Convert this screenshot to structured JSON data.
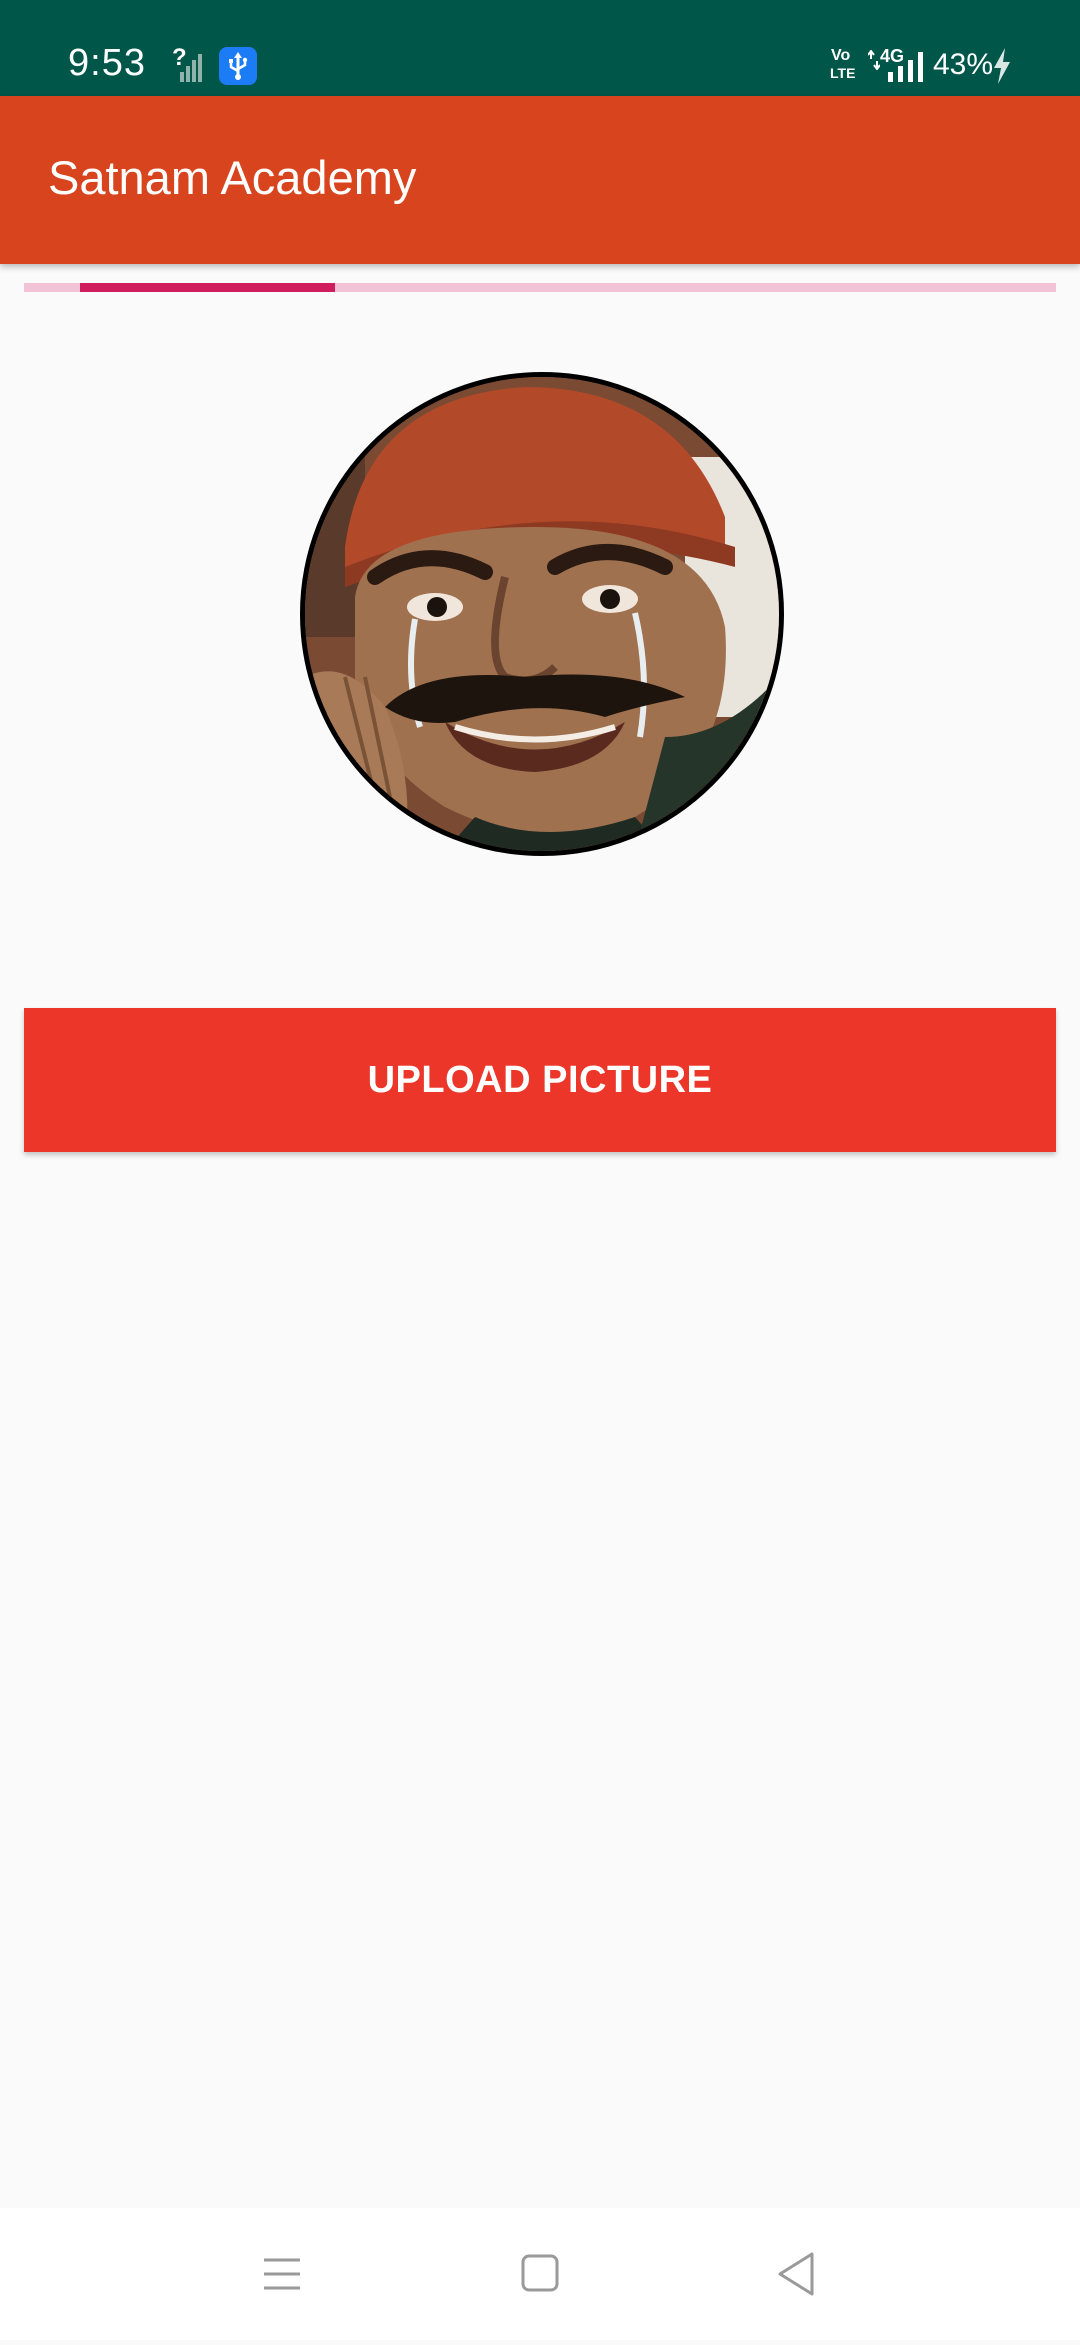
{
  "status_bar": {
    "time": "9:53",
    "unknown_signal_mark": "?",
    "volte_top": "Vo",
    "volte_bottom": "LTE",
    "network": "4G",
    "battery": "43%",
    "icons": [
      "signal-unknown-icon",
      "usb-icon",
      "volte-icon",
      "data-arrows-icon",
      "signal-icon",
      "charging-icon"
    ]
  },
  "app_bar": {
    "title": "Satnam Academy"
  },
  "progress": {
    "indeterminate": true,
    "track_color": "#f1c3d4",
    "indicator_color": "#d01d5d"
  },
  "profile": {
    "avatar_icon": "profile-picture"
  },
  "actions": {
    "upload_label": "UPLOAD PICTURE",
    "upload_color": "#eb3629"
  },
  "nav_bar": {
    "items": [
      "menu-icon",
      "home-icon",
      "back-icon"
    ]
  },
  "colors": {
    "status_bar": "#01564a",
    "app_bar": "#d8441e",
    "background": "#fafafa"
  }
}
